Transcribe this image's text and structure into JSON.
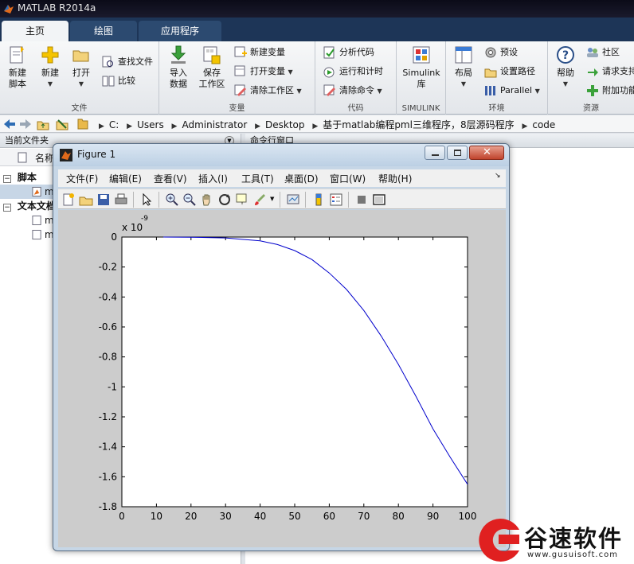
{
  "app": {
    "title": "MATLAB R2014a"
  },
  "tabs": [
    {
      "label": "主页",
      "active": true
    },
    {
      "label": "绘图",
      "active": false
    },
    {
      "label": "应用程序",
      "active": false
    }
  ],
  "ribbon": {
    "file": {
      "label": "文件",
      "new_script": "新建\n脚本",
      "new": "新建",
      "open": "打开",
      "find_files": "查找文件",
      "compare": "比较"
    },
    "variable": {
      "label": "变量",
      "import": "导入\n数据",
      "save_ws": "保存\n工作区",
      "new_var": "新建变量",
      "open_var": "打开变量",
      "clear_ws": "清除工作区"
    },
    "code": {
      "label": "代码",
      "analyze": "分析代码",
      "run_time": "运行和计时",
      "clear_cmd": "清除命令"
    },
    "simulink": {
      "label": "SIMULINK",
      "btn": "Simulink\n库"
    },
    "env": {
      "label": "环境",
      "layout": "布局",
      "prefs": "预设",
      "set_path": "设置路径",
      "parallel": "Parallel"
    },
    "res": {
      "label": "资源",
      "help": "帮助",
      "community": "社区",
      "support": "请求支持",
      "addons": "附加功能"
    }
  },
  "address": {
    "crumbs": [
      "C:",
      "Users",
      "Administrator",
      "Desktop",
      "基于matlab编程pml三维程序，8层源码程序",
      "code"
    ]
  },
  "current_folder": {
    "title": "当前文件夹",
    "col_name": "名称",
    "group_script": "脚本",
    "script_item": "m",
    "group_text": "文本文档",
    "text_items": [
      "m",
      "m"
    ]
  },
  "command_window": {
    "title": "命令行窗口"
  },
  "figure": {
    "title": "Figure 1",
    "menus": [
      "文件(F)",
      "编辑(E)",
      "查看(V)",
      "插入(I)",
      "工具(T)",
      "桌面(D)",
      "窗口(W)",
      "帮助(H)"
    ]
  },
  "chart_data": {
    "type": "line",
    "title": "",
    "xlabel": "",
    "ylabel": "",
    "exponent_label": "x 10",
    "exponent_power": "-9",
    "xlim": [
      0,
      100
    ],
    "ylim": [
      -1.8,
      0
    ],
    "xticks": [
      0,
      10,
      20,
      30,
      40,
      50,
      60,
      70,
      80,
      90,
      100
    ],
    "yticks": [
      0,
      -0.2,
      -0.4,
      -0.6,
      -0.8,
      -1,
      -1.2,
      -1.4,
      -1.6,
      -1.8
    ],
    "ytick_labels": [
      "0",
      "-0.2",
      "-0.4",
      "-0.6",
      "-0.8",
      "-1",
      "-1.2",
      "-1.4",
      "-1.6",
      "-1.8"
    ],
    "grid": false,
    "line_color": "#0000cc",
    "series": [
      {
        "x": [
          12,
          20,
          30,
          40,
          45,
          50,
          55,
          60,
          65,
          70,
          75,
          80,
          85,
          90,
          95,
          100
        ],
        "y": [
          0,
          -0.001,
          -0.006,
          -0.025,
          -0.05,
          -0.09,
          -0.15,
          -0.24,
          -0.35,
          -0.49,
          -0.66,
          -0.85,
          -1.06,
          -1.28,
          -1.47,
          -1.65
        ]
      }
    ]
  },
  "watermark": {
    "text": "谷速软件",
    "url": "www.gusuisoft.com"
  }
}
